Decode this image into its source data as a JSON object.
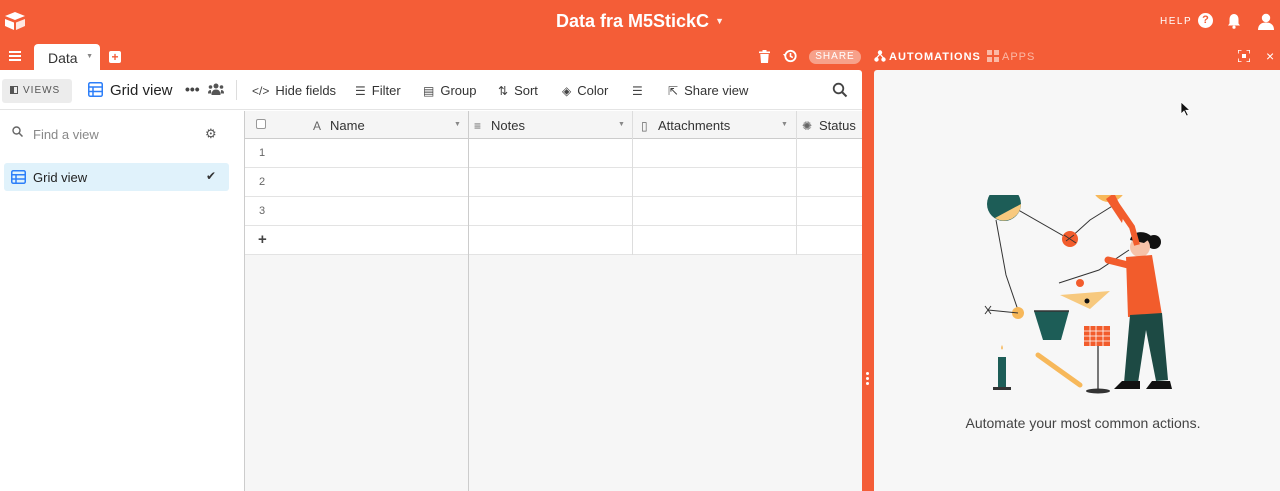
{
  "header": {
    "base_title": "Data fra M5StickC",
    "help_label": "HELP",
    "help_glyph": "?"
  },
  "tabbar": {
    "table_tab": "Data",
    "add_table_glyph": "+",
    "share_label": "SHARE",
    "automations_label": "AUTOMATIONS",
    "apps_label": "APPS",
    "close_glyph": "×"
  },
  "viewbar": {
    "views_label": "VIEWS",
    "view_name": "Grid view",
    "more_glyph": "•••",
    "tools": [
      {
        "label": "Hide fields",
        "icon": "hide-fields-icon"
      },
      {
        "label": "Filter",
        "icon": "filter-icon"
      },
      {
        "label": "Group",
        "icon": "group-icon"
      },
      {
        "label": "Sort",
        "icon": "sort-icon"
      },
      {
        "label": "Color",
        "icon": "color-icon"
      },
      {
        "label": "",
        "icon": "row-height-icon"
      },
      {
        "label": "Share view",
        "icon": "share-view-icon"
      }
    ]
  },
  "sidebar": {
    "find_placeholder": "Find a view",
    "views": [
      {
        "label": "Grid view",
        "selected": true
      }
    ]
  },
  "grid": {
    "columns": [
      {
        "label": "Name",
        "icon": "text-field-icon"
      },
      {
        "label": "Notes",
        "icon": "long-text-icon"
      },
      {
        "label": "Attachments",
        "icon": "attachment-icon"
      },
      {
        "label": "Status",
        "icon": "status-icon"
      }
    ],
    "rows": [
      "1",
      "2",
      "3"
    ],
    "add_row_glyph": "+"
  },
  "automations_panel": {
    "message": "Automate your most common actions."
  },
  "colors": {
    "brand": "#f45d37",
    "selected_view_bg": "#e0f2fb",
    "grid_icon": "#2d7ff9",
    "illustration_teal": "#1d5d57",
    "illustration_orange": "#f25c2c",
    "illustration_yellow": "#f7b85a"
  }
}
